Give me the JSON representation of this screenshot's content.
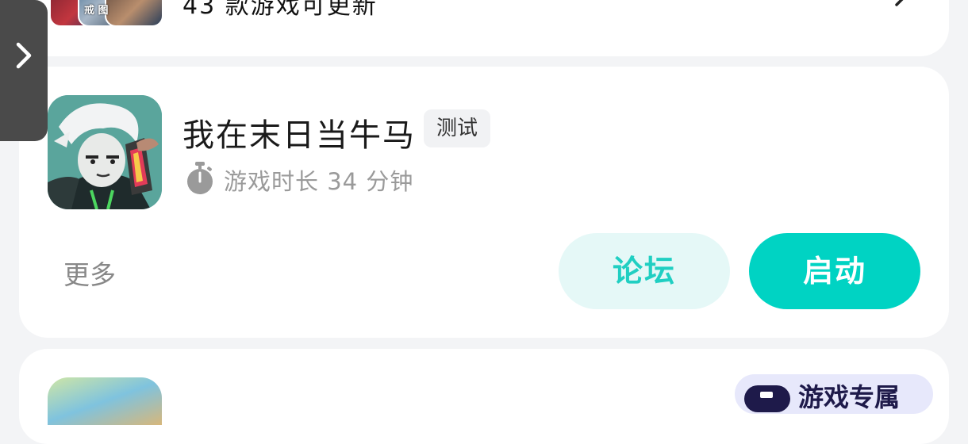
{
  "updates": {
    "count_text": "43 款游戏可更新",
    "thumb_label": "戒 图"
  },
  "game": {
    "title": "我在末日当牛马",
    "tag": "测试",
    "playtime": "游戏时长 34 分钟"
  },
  "actions": {
    "more": "更多",
    "forum": "论坛",
    "start": "启动"
  },
  "next_card": {
    "badge": "游戏专属"
  },
  "colors": {
    "accent": "#00d3c3",
    "accent_light": "#e5f8f7",
    "background": "#f3f4f6"
  },
  "icons": [
    "chevron-right-icon",
    "arrow-icon",
    "stopwatch-icon",
    "gamepad-icon"
  ]
}
